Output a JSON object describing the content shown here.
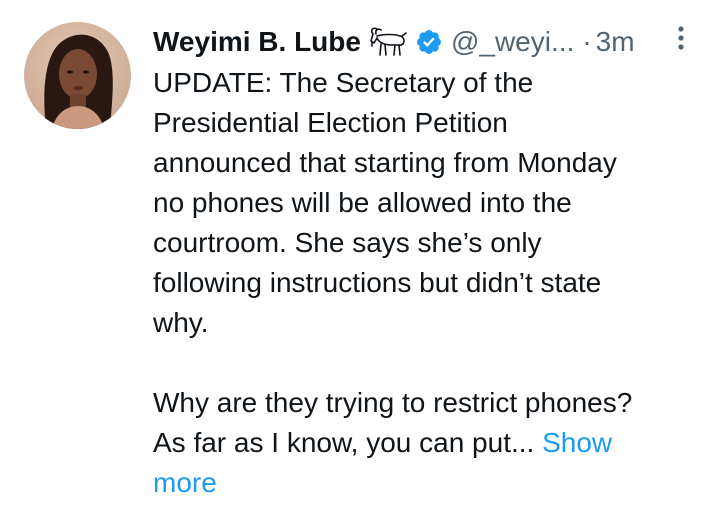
{
  "tweet": {
    "author": {
      "display_name": "Weyimi B. Lube",
      "handle": "@_weyi...",
      "name_emoji": "goat-icon",
      "verified_badge": "verified-icon",
      "verified_color": "#1d9bf0"
    },
    "separator": "·",
    "time": "3m",
    "more_menu_icon": "more-vertical-icon",
    "text_lines": [
      "UPDATE: The Secretary of the",
      "Presidential Election Petition",
      "announced that starting from Monday",
      "no phones will be allowed into the",
      "courtroom. She says she’s only",
      "following instructions but didn’t state",
      "why.",
      "",
      "Why are they trying to restrict phones?",
      "As far as I know, you can put..."
    ],
    "show_more_label": "Show",
    "show_more_label_2": "more",
    "link_color": "#1d9bf0"
  }
}
